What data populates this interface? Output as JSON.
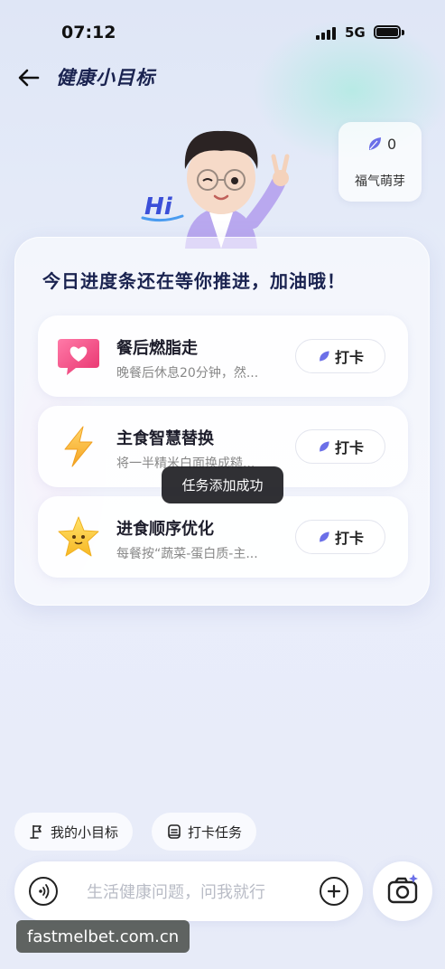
{
  "status_bar": {
    "time": "07:12",
    "network": "5G"
  },
  "header": {
    "title": "健康小目标"
  },
  "points": {
    "value": "0",
    "label": "福气萌芽"
  },
  "avatar": {
    "greeting": "Hi"
  },
  "main": {
    "heading": "今日进度条还在等你推进，加油哦！",
    "tasks": [
      {
        "title": "餐后燃脂走",
        "desc": "晚餐后休息20分钟，然...",
        "button": "打卡",
        "icon": "heart-chat-icon"
      },
      {
        "title": "主食智慧替换",
        "desc": "将一半精米白面换成糙...",
        "button": "打卡",
        "icon": "lightning-icon"
      },
      {
        "title": "进食顺序优化",
        "desc": "每餐按“蔬菜-蛋白质-主...",
        "button": "打卡",
        "icon": "star-icon"
      }
    ]
  },
  "toast": "任务添加成功",
  "bottom": {
    "chips": [
      "我的小目标",
      "打卡任务"
    ],
    "input_placeholder": "生活健康问题，问我就行"
  },
  "watermark": "fastmelbet.com.cn",
  "colors": {
    "accent": "#6b6fe8",
    "title": "#1a2350",
    "toast_bg": "#1e1e23"
  }
}
